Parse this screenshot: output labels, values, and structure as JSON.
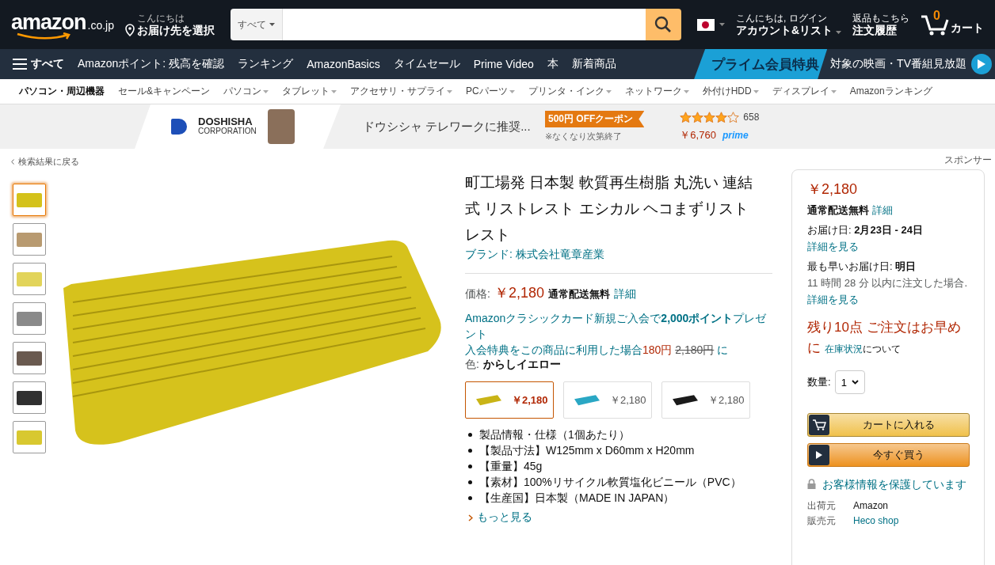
{
  "header": {
    "logo": "amazon",
    "logo_suffix": ".co.jp",
    "location": {
      "line1": "こんにちは",
      "line2": "お届け先を選択"
    },
    "search": {
      "category": "すべて"
    },
    "account": {
      "line1": "こんにちは, ログイン",
      "line2": "アカウント&リスト"
    },
    "orders": {
      "line1": "返品もこちら",
      "line2": "注文履歴"
    },
    "cart": {
      "count": "0",
      "label": "カート"
    }
  },
  "nav": {
    "menu_label": "すべて",
    "items": [
      "Amazonポイント: 残高を確認",
      "ランキング",
      "AmazonBasics",
      "タイムセール",
      "Prime Video",
      "本",
      "新着商品"
    ],
    "prime_banner": "プライム会員特典",
    "prime_promo": "対象の映画・TV番組見放題"
  },
  "subnav": {
    "items": [
      {
        "label": "パソコン・周辺機器",
        "kind": "title"
      },
      {
        "label": "セール&キャンペーン",
        "kind": "link"
      },
      {
        "label": "パソコン",
        "kind": "dropdown"
      },
      {
        "label": "タブレット",
        "kind": "dropdown"
      },
      {
        "label": "アクセサリ・サプライ",
        "kind": "dropdown"
      },
      {
        "label": "PCパーツ",
        "kind": "dropdown"
      },
      {
        "label": "プリンタ・インク",
        "kind": "dropdown"
      },
      {
        "label": "ネットワーク",
        "kind": "dropdown"
      },
      {
        "label": "外付けHDD",
        "kind": "dropdown"
      },
      {
        "label": "ディスプレイ",
        "kind": "dropdown"
      },
      {
        "label": "Amazonランキング",
        "kind": "link"
      }
    ]
  },
  "ad": {
    "brand_line1": "DOSHISHA",
    "brand_line2": "CORPORATION",
    "text": "ドウシシャ テレワークに推奨...",
    "coupon": "500円 OFFクーポン",
    "note": "※なくなり次第終了",
    "stars": 4,
    "rating_count": "658",
    "price": "￥6,760",
    "prime": "prime"
  },
  "breadcrumb": "検索結果に戻る",
  "sponsor": "スポンサー",
  "thumbnails": [
    {
      "selected": true,
      "color": "#d4c21a"
    },
    {
      "selected": false,
      "color": "#b89a70"
    },
    {
      "selected": false,
      "color": "#e2d45a"
    },
    {
      "selected": false,
      "color": "#8a8a8a"
    },
    {
      "selected": false,
      "color": "#6a5a50"
    },
    {
      "selected": false,
      "color": "#303030"
    },
    {
      "selected": false,
      "color": "#d8c830"
    }
  ],
  "product": {
    "title": "町工場発 日本製 軟質再生樹脂 丸洗い 連結式 リストレスト エシカル ヘコまずリストレスト",
    "brand": "ブランド: 株式会社竜章産業",
    "price_label": "価格:",
    "price": "￥2,180",
    "shipping": "通常配送無料",
    "shipping_link": "詳細",
    "card_promo": "Amazonクラシックカード新規ご入会で**2,000ポイント**プレゼント",
    "benefit_prefix": "入会特典をこの商品に利用した場合",
    "benefit_discount": "180円",
    "benefit_original": "2,180円",
    "benefit_suffix": "に",
    "color_label": "色:",
    "color_value": "からしイエロー",
    "variants": [
      {
        "price": "￥2,180",
        "selected": true,
        "color": "#c9b416"
      },
      {
        "price": "￥2,180",
        "selected": false,
        "color": "#2aa7c4"
      },
      {
        "price": "￥2,180",
        "selected": false,
        "color": "#1a1a1a"
      }
    ],
    "bullets": [
      "製品情報・仕様（1個あたり）",
      "【製品寸法】W125mm x D60mm x H20mm",
      "【重量】45g",
      "【素材】100%リサイクル軟質塩化ビニール（PVC）",
      "【生産国】日本製（MADE IN JAPAN）"
    ],
    "more": "もっと見る"
  },
  "buybox": {
    "price": "￥2,180",
    "shipping": "通常配送無料",
    "shipping_link": "詳細",
    "delivery_label": "お届け日:",
    "delivery_date": "2月23日 - 24日",
    "delivery_link": "詳細を見る",
    "fastest_label": "最も早いお届け日:",
    "fastest_value": "明日",
    "countdown": "11 時間 28 分 以内に注文した場合.",
    "countdown_link": "詳細を見る",
    "stock": "残り10点 ご注文はお早めに",
    "stock_link": "在庫状況",
    "stock_suffix": "について",
    "qty_label": "数量:",
    "qty": "1",
    "add_to_cart": "カートに入れる",
    "buy_now": "今すぐ買う",
    "secure": "お客様情報を保護しています",
    "seller_rows": [
      {
        "label": "出荷元",
        "value": "Amazon",
        "link": false
      },
      {
        "label": "販売元",
        "value": "Heco shop",
        "link": true
      }
    ]
  }
}
